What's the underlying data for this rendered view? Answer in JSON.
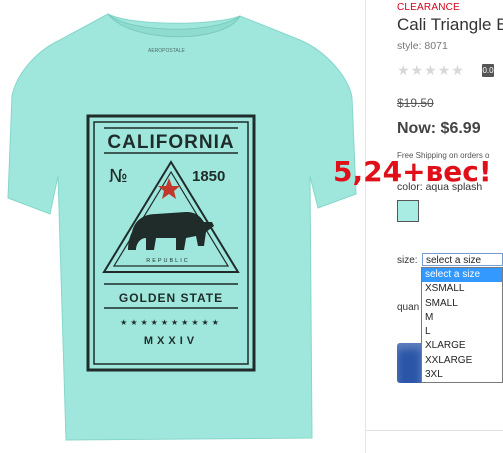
{
  "product": {
    "badge": "CLEARANCE",
    "title": "Cali Triangle B",
    "style": "style: 8071",
    "rating_count": "0.0",
    "old_price": "$19.50",
    "now_price": "Now: $6.99",
    "shipping": "Free Shipping on orders o",
    "color_label": "color: aqua splash",
    "swatch_color": "#a9ece3"
  },
  "graphic": {
    "neck_label": "AEROPOSTALE",
    "headline": "CALIFORNIA",
    "no": "№",
    "year": "1850",
    "republic": "REPUBLIC",
    "subline": "GOLDEN STATE",
    "roman": "MXXIV",
    "stars": "★★★★★★★★★★"
  },
  "size": {
    "label": "size:",
    "selected": "select a size",
    "options": [
      "select a size",
      "XSMALL",
      "SMALL",
      "M",
      "L",
      "XLARGE",
      "XXLARGE",
      "3XL"
    ]
  },
  "quantity": {
    "label": "quan"
  },
  "overlay": {
    "text": "5,24+вес!"
  },
  "colors": {
    "shirt": "#9fe7dc",
    "ink": "#1f2c2a",
    "accent_red": "#d0021b",
    "star": "#c0392b"
  }
}
